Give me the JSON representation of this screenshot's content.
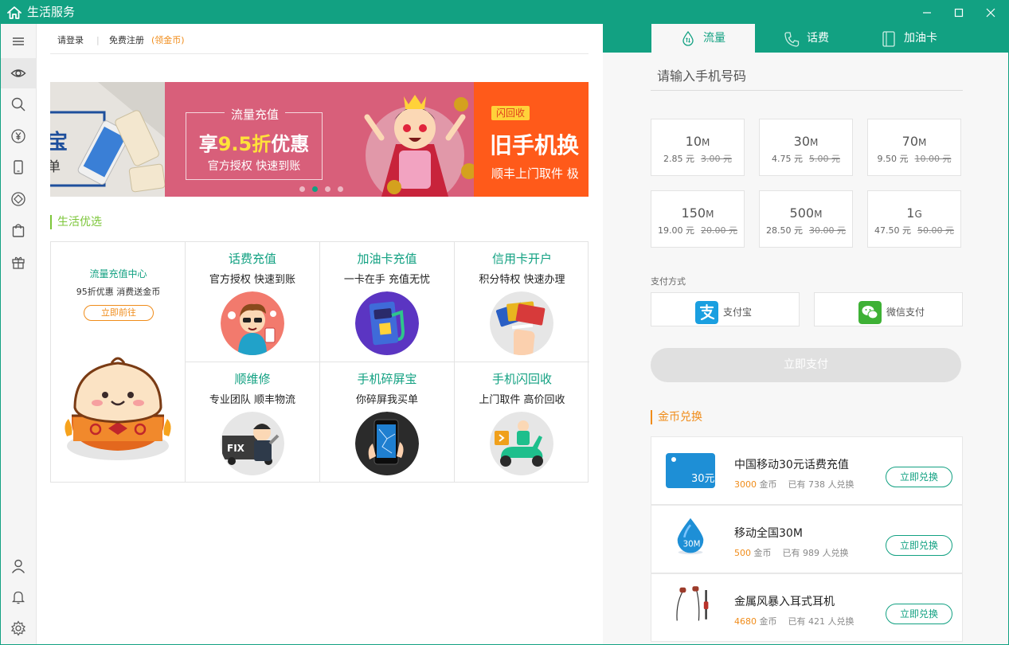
{
  "app": {
    "title": "生活服务"
  },
  "header": {
    "login": "请登录",
    "register": "免费注册",
    "coins": "(领金币)"
  },
  "banner": {
    "left": {
      "t1": "宝",
      "t2": "单"
    },
    "center": {
      "title": "流量充值",
      "discount_pre": "享",
      "discount_num": "9.5折",
      "discount_post": "优惠",
      "sub": "官方授权 快速到账"
    },
    "right": {
      "tag": "闪回收",
      "title": "旧手机换",
      "sub": "顺丰上门取件 极"
    },
    "active_dot": 1,
    "dot_count": 4
  },
  "section": {
    "title": "生活优选"
  },
  "featured": {
    "title": "流量充值中心",
    "sub": "95折优惠 消费送金币",
    "button": "立即前往"
  },
  "services": [
    {
      "title": "话费充值",
      "sub": "官方授权 快速到账",
      "icon": "phone-recharge-mascot",
      "color": "#f27a6d"
    },
    {
      "title": "加油卡充值",
      "sub": "一卡在手 充值无忧",
      "icon": "fuel-card-icon",
      "color": "#5b35c2"
    },
    {
      "title": "信用卡开户",
      "sub": "积分特权 快速办理",
      "icon": "credit-card-icon",
      "color": "#e6e6e6"
    },
    {
      "title": "顺维修",
      "sub": "专业团队 顺丰物流",
      "icon": "repair-truck-icon",
      "color": "#e6e6e6"
    },
    {
      "title": "手机碎屏宝",
      "sub": "你碎屏我买单",
      "icon": "broken-screen-phone-icon",
      "color": "#2b2b2b"
    },
    {
      "title": "手机闪回收",
      "sub": "上门取件 高价回收",
      "icon": "scooter-courier-icon",
      "color": "#e6e6e6"
    }
  ],
  "right": {
    "tabs": [
      {
        "label": "流量",
        "icon": "drop-icon",
        "active": true
      },
      {
        "label": "话费",
        "icon": "phone-icon",
        "active": false
      },
      {
        "label": "加油卡",
        "icon": "fuel-card-icon",
        "active": false
      }
    ],
    "phone_placeholder": "请输入手机号码",
    "packages": [
      {
        "size": "10",
        "unit": "M",
        "price": "2.85 元",
        "original": "3.00 元"
      },
      {
        "size": "30",
        "unit": "M",
        "price": "4.75 元",
        "original": "5.00 元"
      },
      {
        "size": "70",
        "unit": "M",
        "price": "9.50 元",
        "original": "10.00 元"
      },
      {
        "size": "150",
        "unit": "M",
        "price": "19.00 元",
        "original": "20.00 元"
      },
      {
        "size": "500",
        "unit": "M",
        "price": "28.50 元",
        "original": "30.00 元"
      },
      {
        "size": "1",
        "unit": "G",
        "price": "47.50 元",
        "original": "50.00 元"
      }
    ],
    "payment": {
      "label": "支付方式",
      "alipay": {
        "label": "支付宝",
        "icon": "alipay-icon",
        "color": "#1a9fe0"
      },
      "wechat": {
        "label": "微信支付",
        "icon": "wechat-pay-icon",
        "color": "#3eb135"
      },
      "button": "立即支付"
    },
    "coin_title": "金币兑换",
    "exchanges": [
      {
        "name": "中国移动30元话费充值",
        "coins": "3000",
        "coins_unit": "金币",
        "count_text": "已有 738 人兑换",
        "button": "立即兑换",
        "thumb_text": "30元"
      },
      {
        "name": "移动全国30M",
        "coins": "500",
        "coins_unit": "金币",
        "count_text": "已有 989 人兑换",
        "button": "立即兑换",
        "thumb_text": "30M"
      },
      {
        "name": "金属风暴入耳式耳机",
        "coins": "4680",
        "coins_unit": "金币",
        "count_text": "已有 421 人兑换",
        "button": "立即兑换",
        "thumb_text": ""
      }
    ]
  },
  "colors": {
    "brand": "#12a182",
    "accent": "#f08c1a",
    "green": "#7cc639"
  }
}
